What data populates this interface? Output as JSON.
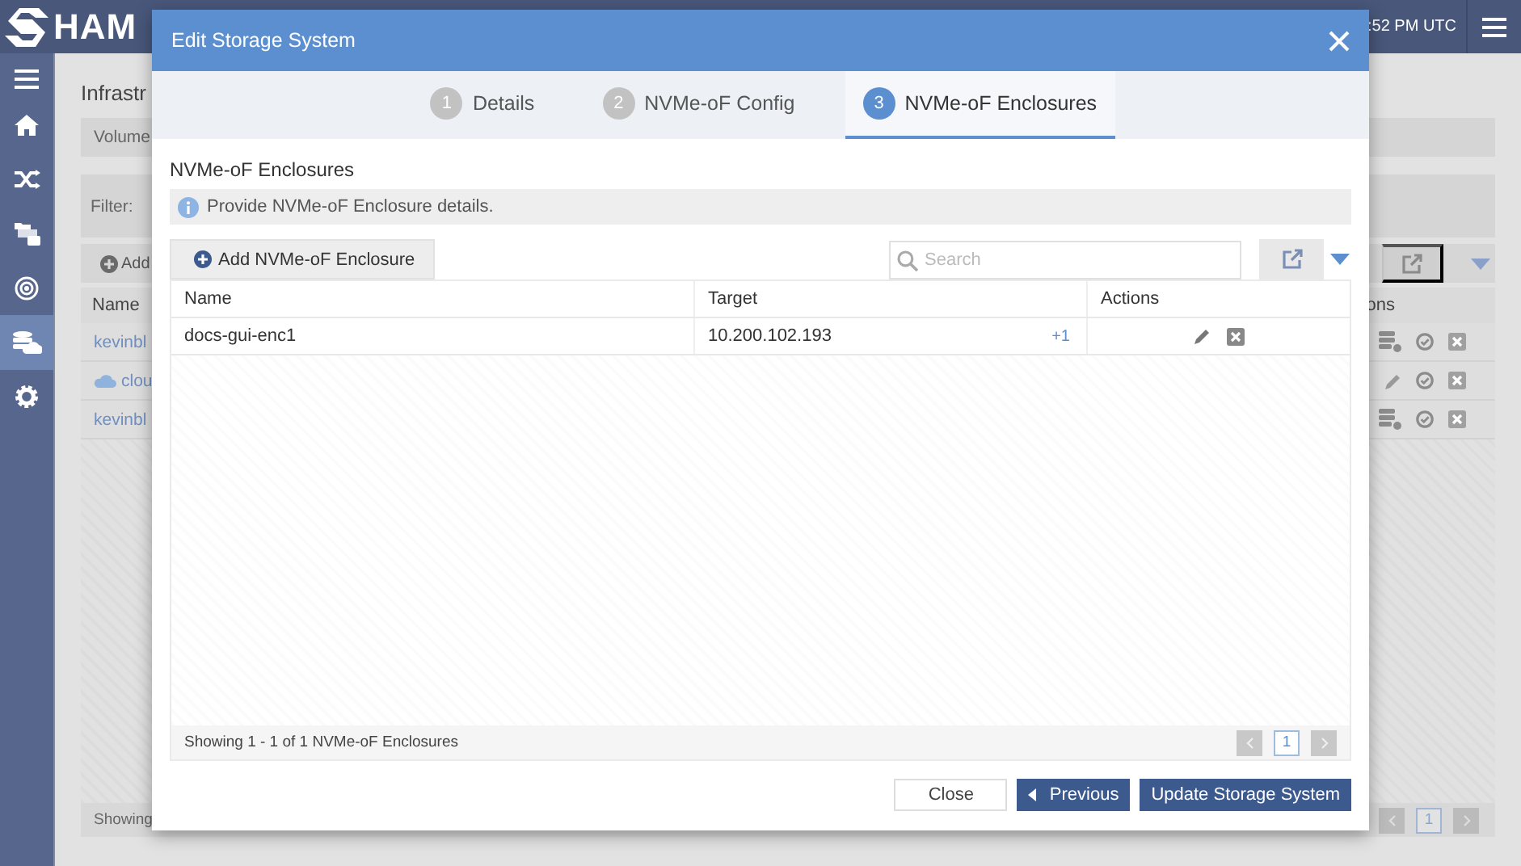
{
  "app": {
    "logo_text": "HAM",
    "clock": ":52 PM UTC",
    "sidebar": {
      "items": [
        {
          "selected": false
        },
        {
          "selected": false
        },
        {
          "selected": false
        },
        {
          "selected": false
        },
        {
          "selected": true
        },
        {
          "selected": false
        }
      ]
    }
  },
  "page": {
    "title": "Infrastr",
    "tab": "Volume",
    "filter_label": "Filter:",
    "add_label": "Add",
    "column_left": "Name",
    "column_right": "ons",
    "rows": [
      {
        "name": "kevinbl",
        "kind": "link"
      },
      {
        "name": "clou",
        "kind": "cloud"
      },
      {
        "name": "kevinbl",
        "kind": "link"
      }
    ],
    "footer": "Showing",
    "page": "1"
  },
  "dialog": {
    "title": "Edit Storage System",
    "steps": [
      {
        "number": "1",
        "label": "Details",
        "selected": false
      },
      {
        "number": "2",
        "label": "NVMe-oF Config",
        "selected": false
      },
      {
        "number": "3",
        "label": "NVMe-oF Enclosures",
        "selected": true
      }
    ],
    "section_title": "NVMe-oF Enclosures",
    "info": "Provide NVMe-oF Enclosure details.",
    "add_button": "Add NVMe-oF Enclosure",
    "search": {
      "placeholder": "Search"
    },
    "table": {
      "columns": [
        "Name",
        "Target",
        "Actions"
      ],
      "rows": [
        {
          "name": "docs-gui-enc1",
          "target": "10.200.102.193",
          "target_more": "+1"
        }
      ]
    },
    "footer": "Showing 1 - 1 of 1 NVMe-oF Enclosures",
    "page": "1",
    "buttons": [
      {
        "label": "Close",
        "kind": "secondary"
      },
      {
        "label": "Previous",
        "kind": "back"
      },
      {
        "label": "Update Storage System",
        "kind": "primary"
      }
    ]
  }
}
